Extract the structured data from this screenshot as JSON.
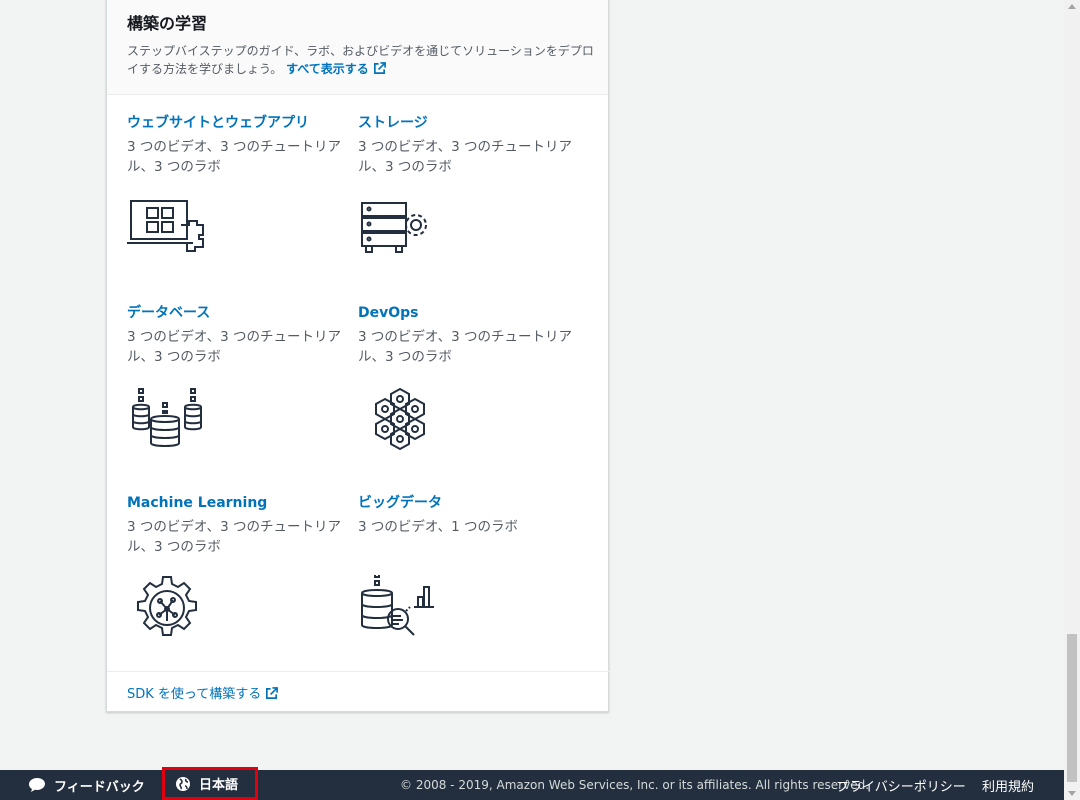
{
  "card": {
    "title": "構築の学習",
    "description": "ステップバイステップのガイド、ラボ、およびビデオを通じてソリューションをデプロイする方法を学びましょう。",
    "view_all_label": "すべて表示する",
    "tiles": [
      {
        "title": "ウェブサイトとウェブアプリ",
        "desc": "3 つのビデオ、3 つのチュートリアル、3 つのラボ",
        "icon": "webapp-icon"
      },
      {
        "title": "ストレージ",
        "desc": "3 つのビデオ、3 つのチュートリアル、3 つのラボ",
        "icon": "storage-icon"
      },
      {
        "title": "データベース",
        "desc": "3 つのビデオ、3 つのチュートリアル、3 つのラボ",
        "icon": "database-icon"
      },
      {
        "title": "DevOps",
        "desc": "3 つのビデオ、3 つのチュートリアル、3 つのラボ",
        "icon": "devops-icon"
      },
      {
        "title": "Machine Learning",
        "desc": "3 つのビデオ、3 つのチュートリアル、3 つのラボ",
        "icon": "machine-learning-icon"
      },
      {
        "title": "ビッグデータ",
        "desc": "3 つのビデオ、1 つのラボ",
        "icon": "big-data-icon"
      }
    ],
    "sdk_link": "SDK を使って構築する"
  },
  "footer": {
    "feedback": "フィードバック",
    "language": "日本語",
    "copyright": "© 2008 - 2019, Amazon Web Services, Inc. or its affiliates. All rights reserved.",
    "privacy": "プライバシーポリシー",
    "terms": "利用規約"
  },
  "colors": {
    "link": "#0073bb",
    "footer_bg": "#232f3e",
    "highlight": "#e0000f"
  }
}
